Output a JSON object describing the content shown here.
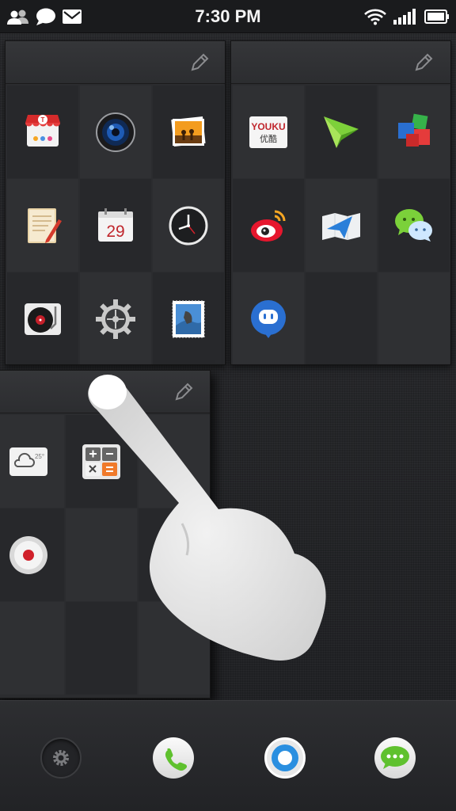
{
  "status_bar": {
    "time": "7:30 PM",
    "left_icons": [
      "contacts-icon",
      "chat-bubble-icon",
      "mail-icon"
    ],
    "right_icons": [
      "wifi-icon",
      "signal-icon",
      "battery-icon"
    ]
  },
  "panels": [
    {
      "name": "panel-top-left",
      "apps": [
        "store-icon",
        "camera-icon",
        "gallery-icon",
        "notes-icon",
        "calendar-icon",
        "clock-icon",
        "music-player-icon",
        "settings-gear-icon",
        "photo-stamp-icon"
      ],
      "calendar_date": "29"
    },
    {
      "name": "panel-top-right",
      "apps": [
        "youku-icon",
        "paper-plane-icon",
        "office-cubes-icon",
        "weibo-icon",
        "maps-icon",
        "wechat-icon",
        "chat-ghost-icon"
      ],
      "youku_text": "YOUKU",
      "youku_sub": "优酷"
    },
    {
      "name": "panel-bottom",
      "apps": [
        "weather-icon",
        "calculator-icon",
        "recorder-icon"
      ],
      "weather_temp": "25°"
    }
  ],
  "dock": [
    "dock-settings-icon",
    "phone-icon",
    "browser-icon",
    "messages-icon"
  ],
  "colors": {
    "background": "#1f2023",
    "panel": "#2b2c2f",
    "accent_blue": "#2a7fd9",
    "accent_red": "#d0202a"
  }
}
